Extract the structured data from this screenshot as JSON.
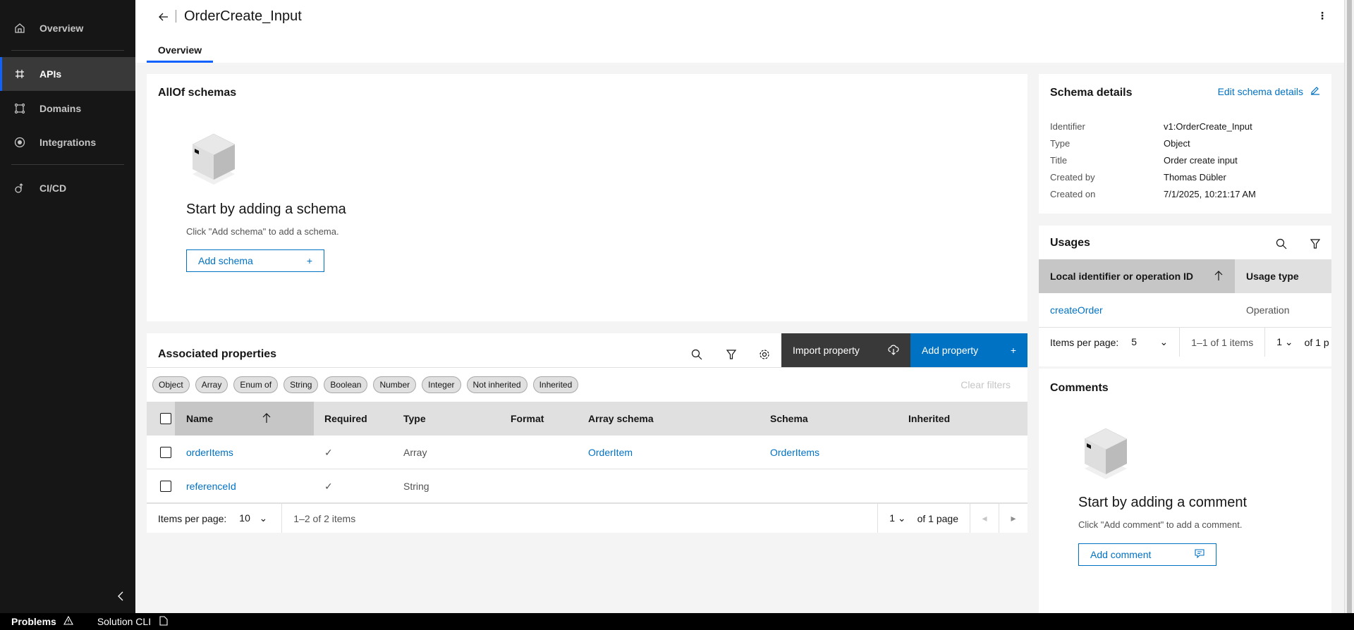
{
  "sidebar": {
    "items": [
      {
        "label": "Overview",
        "icon": "home-icon"
      },
      {
        "label": "APIs",
        "icon": "hash-icon",
        "active": true
      },
      {
        "label": "Domains",
        "icon": "domain-icon"
      },
      {
        "label": "Integrations",
        "icon": "radio-icon"
      },
      {
        "label": "CI/CD",
        "icon": "cicd-icon"
      }
    ]
  },
  "bottom_bar": {
    "problems": "Problems",
    "solution_cli": "Solution CLI"
  },
  "header": {
    "title": "OrderCreate_Input",
    "tabs": [
      {
        "label": "Overview",
        "active": true
      }
    ]
  },
  "allof": {
    "title": "AllOf schemas",
    "empty_heading": "Start by adding a schema",
    "empty_text": "Click \"Add schema\" to add a schema.",
    "add_button": "Add schema"
  },
  "properties": {
    "title": "Associated properties",
    "import_button": "Import property",
    "add_button": "Add property",
    "clear_filters": "Clear filters",
    "filters": [
      "Object",
      "Array",
      "Enum of",
      "String",
      "Boolean",
      "Number",
      "Integer",
      "Not inherited",
      "Inherited"
    ],
    "columns": [
      "Name",
      "Required",
      "Type",
      "Format",
      "Array schema",
      "Schema",
      "Inherited"
    ],
    "rows": [
      {
        "name": "orderItems",
        "required": "✓",
        "type": "Array",
        "format": "",
        "array_schema": "OrderItem",
        "schema": "OrderItems",
        "inherited": ""
      },
      {
        "name": "referenceId",
        "required": "✓",
        "type": "String",
        "format": "",
        "array_schema": "",
        "schema": "",
        "inherited": ""
      }
    ],
    "pagination": {
      "items_per_page_label": "Items per page:",
      "items_per_page": "10",
      "range": "1–2 of 2 items",
      "page": "1",
      "of_pages": "of 1 page"
    }
  },
  "schema_details": {
    "title": "Schema details",
    "edit_link": "Edit schema details",
    "fields": [
      {
        "label": "Identifier",
        "value": "v1:OrderCreate_Input"
      },
      {
        "label": "Type",
        "value": "Object"
      },
      {
        "label": "Title",
        "value": "Order create input"
      },
      {
        "label": "Created by",
        "value": "Thomas Dübler"
      },
      {
        "label": "Created on",
        "value": "7/1/2025, 10:21:17 AM"
      }
    ]
  },
  "usages": {
    "title": "Usages",
    "columns": [
      "Local identifier or operation ID",
      "Usage type"
    ],
    "rows": [
      {
        "id": "createOrder",
        "type": "Operation"
      }
    ],
    "pagination": {
      "items_per_page_label": "Items per page:",
      "items_per_page": "5",
      "range": "1–1 of 1 items",
      "page": "1",
      "of_pages": "of 1 p"
    }
  },
  "comments": {
    "title": "Comments",
    "empty_heading": "Start by adding a comment",
    "empty_text": "Click \"Add comment\" to add a comment.",
    "add_button": "Add comment"
  },
  "colors": {
    "accent": "#0072c3",
    "sidebar": "#161616",
    "import_button": "#393939"
  }
}
